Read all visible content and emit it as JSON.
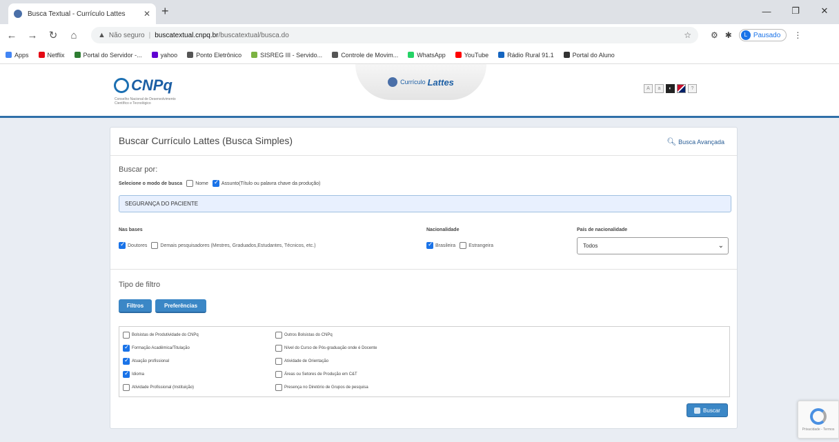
{
  "browser": {
    "tab_title": "Busca Textual - Currículo Lattes",
    "url_warning": "Não seguro",
    "url_host": "buscatextual.cnpq.br",
    "url_path": "/buscatextual/busca.do",
    "profile_initial": "L",
    "profile_label": "Pausado"
  },
  "bookmarks": [
    {
      "label": "Apps",
      "color": "#4285f4"
    },
    {
      "label": "Netflix",
      "color": "#e50914"
    },
    {
      "label": "Portal do Servidor -...",
      "color": "#2e7d32"
    },
    {
      "label": "yahoo",
      "color": "#6001d2"
    },
    {
      "label": "Ponto Eletrônico",
      "color": "#555555"
    },
    {
      "label": "SISREG III - Servido...",
      "color": "#7cb342"
    },
    {
      "label": "Controle de Movim...",
      "color": "#555555"
    },
    {
      "label": "WhatsApp",
      "color": "#25d366"
    },
    {
      "label": "YouTube",
      "color": "#ff0000"
    },
    {
      "label": "Rádio Rural 91.1",
      "color": "#1565c0"
    },
    {
      "label": "Portal do Aluno",
      "color": "#333333"
    }
  ],
  "header": {
    "cnpq": "CNPq",
    "cnpq_sub": "Conselho Nacional de Desenvolvimento Científico e Tecnológico",
    "lattes_small": "Currículo",
    "lattes_big": "Lattes"
  },
  "form": {
    "title": "Buscar Currículo Lattes (Busca Simples)",
    "advanced": "Busca Avançada",
    "buscar_por": "Buscar por:",
    "modo_label": "Selecione o modo de busca",
    "modo_nome": "Nome",
    "modo_assunto": "Assunto(Título ou palavra chave da produção)",
    "query": "SEGURANÇA DO PACIENTE",
    "nas_bases": "Nas bases",
    "base_doutores": "Doutores",
    "base_demais": "Demais pesquisadores (Mestres, Graduados,Estudantes, Técnicos, etc.)",
    "nacionalidade": "Nacionalidade",
    "nac_brasileira": "Brasileira",
    "nac_estrangeira": "Estrangeira",
    "pais_label": "País de nacionalidade",
    "pais_value": "Todos",
    "tipo_filtro": "Tipo de filtro",
    "btn_filtros": "Filtros",
    "btn_preferencias": "Preferências",
    "filters_left": [
      {
        "label": "Bolsistas de Produtividade do CNPq",
        "checked": false
      },
      {
        "label": "Formação Acadêmica/Titulação",
        "checked": true
      },
      {
        "label": "Atuação profissional",
        "checked": true
      },
      {
        "label": "Idioma",
        "checked": true
      },
      {
        "label": "Atividade Profissional (Instituição)",
        "checked": false
      }
    ],
    "filters_right": [
      {
        "label": "Outros Bolsistas do CNPq",
        "checked": false
      },
      {
        "label": "Nível do Curso de Pós-graduação onde é Docente",
        "checked": false
      },
      {
        "label": "Atividade de Orientação",
        "checked": false
      },
      {
        "label": "Áreas ou Setores de Produção em C&T",
        "checked": false
      },
      {
        "label": "Presença no Diretório de Grupos de pesquisa",
        "checked": false
      }
    ],
    "btn_buscar": "Buscar"
  },
  "recaptcha": {
    "text": "Privacidade - Termos"
  }
}
